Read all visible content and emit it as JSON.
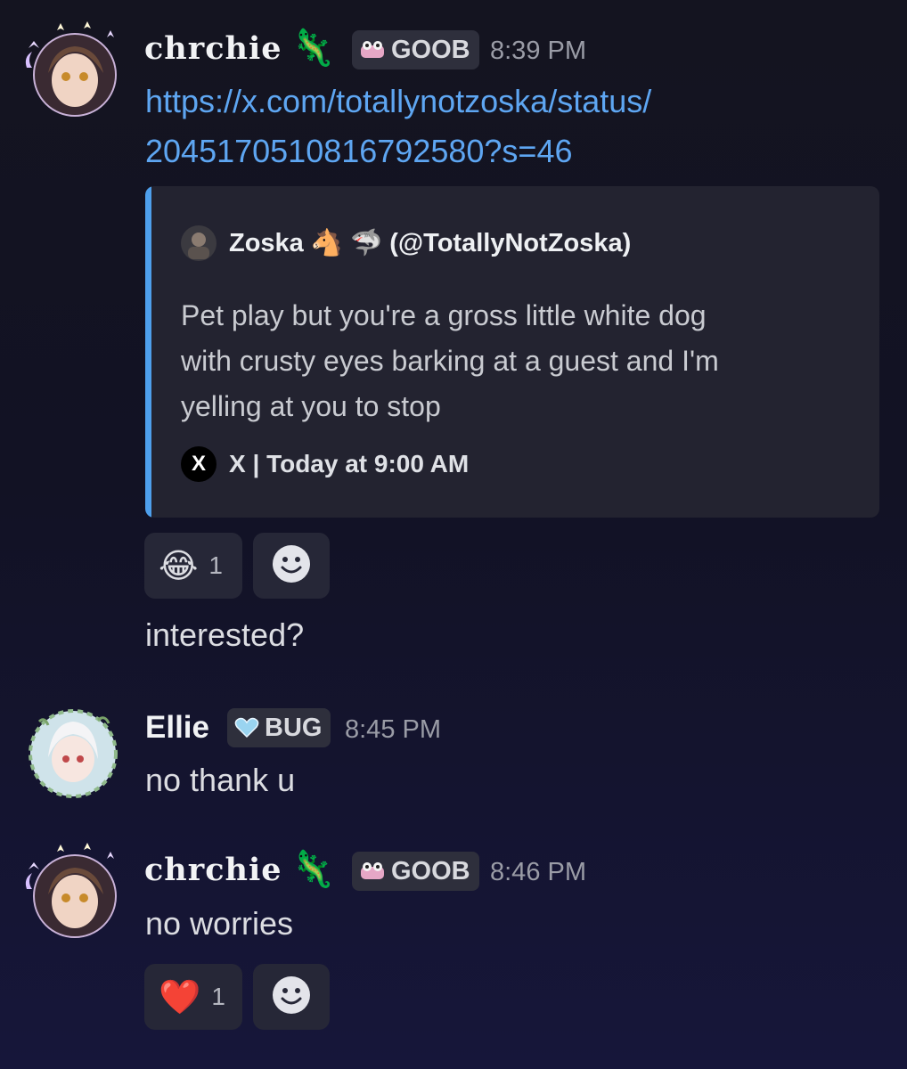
{
  "messages": [
    {
      "author": "chrchie",
      "emoji": "🦎",
      "tag": "GOOB",
      "time": "8:39 PM",
      "link_lines": [
        "https://x.com/totallynotzoska/status/",
        "2045170510816792580?s=46"
      ],
      "embed": {
        "author": "Zoska 🐴 🦈 (@TotallyNotZoska)",
        "description_lines": [
          "Pet play but you're a gross little white dog",
          "with crusty eyes barking at a guest and I'm",
          "yelling at you to stop"
        ],
        "footer": "X | Today at 9:00 AM",
        "footer_icon": "X",
        "accent_color": "#4e9fec"
      },
      "reactions": [
        {
          "emoji": "😂",
          "count": "1"
        }
      ],
      "followup": "interested?"
    },
    {
      "author": "Ellie",
      "tag": "BUG",
      "time": "8:45 PM",
      "text": "no thank u"
    },
    {
      "author": "chrchie",
      "emoji": "🦎",
      "tag": "GOOB",
      "time": "8:46 PM",
      "text": "no worries",
      "reactions": [
        {
          "emoji": "❤️",
          "count": "1"
        }
      ]
    }
  ],
  "icons": {
    "add_reaction": "smiley-add-reaction-icon",
    "goob_tag": "frog-icon",
    "bug_tag": "blue-heart-icon"
  },
  "colors": {
    "link": "#5ea6f2",
    "embed_bar": "#4e9fec",
    "timestamp": "#9a9ca6"
  }
}
